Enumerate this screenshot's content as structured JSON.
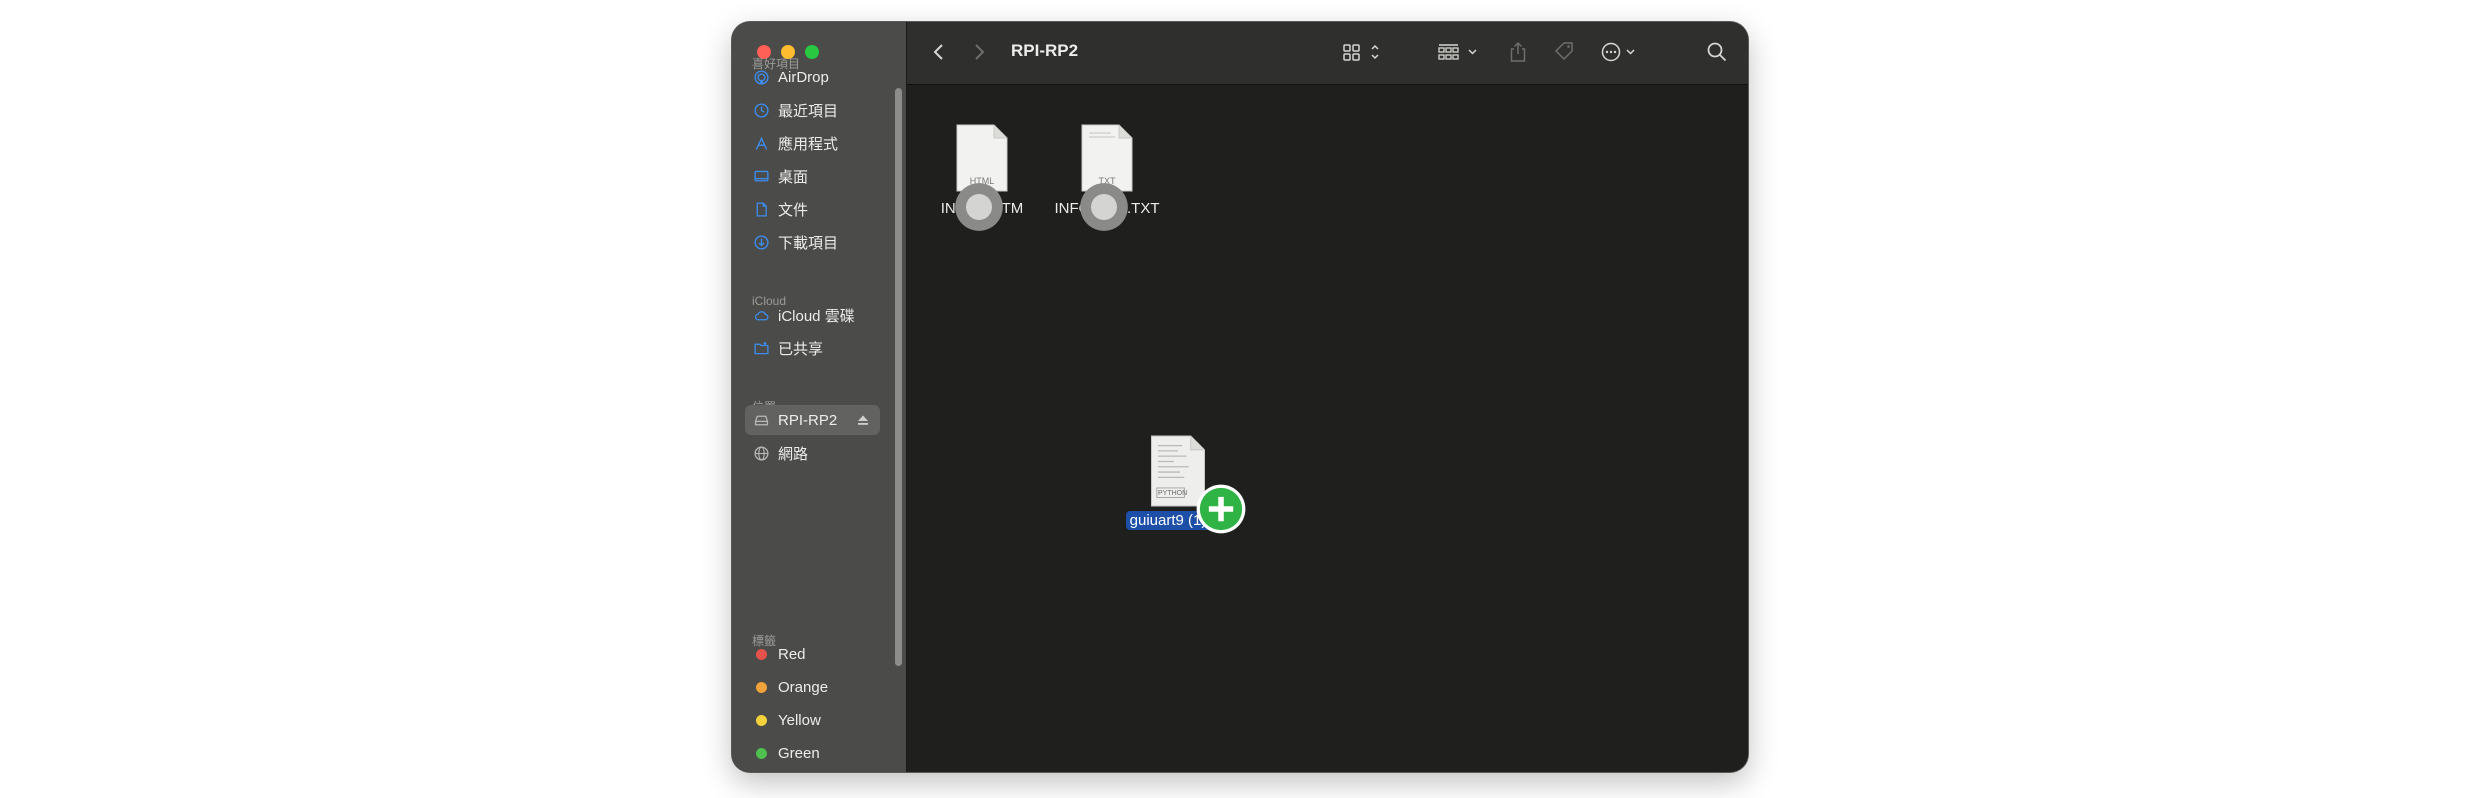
{
  "window": {
    "title": "RPI-RP2"
  },
  "sidebar": {
    "favorites_title": "喜好項目",
    "favorites": [
      {
        "label": "AirDrop",
        "icon": "airdrop-icon"
      },
      {
        "label": "最近項目",
        "icon": "clock-icon"
      },
      {
        "label": "應用程式",
        "icon": "applications-icon"
      },
      {
        "label": "桌面",
        "icon": "desktop-icon"
      },
      {
        "label": "文件",
        "icon": "document-icon"
      },
      {
        "label": "下載項目",
        "icon": "download-icon"
      }
    ],
    "icloud_title": "iCloud",
    "icloud": [
      {
        "label": "iCloud 雲碟",
        "icon": "cloud-icon"
      },
      {
        "label": "已共享",
        "icon": "shared-folder-icon"
      }
    ],
    "locations_title": "位置",
    "locations": [
      {
        "label": "RPI-RP2",
        "icon": "drive-icon",
        "selected": true
      },
      {
        "label": "網路",
        "icon": "globe-icon"
      }
    ],
    "tags_title": "標籤",
    "tags": [
      {
        "label": "Red",
        "color": "#e5514b"
      },
      {
        "label": "Orange",
        "color": "#f0a33a"
      },
      {
        "label": "Yellow",
        "color": "#f5d13b"
      },
      {
        "label": "Green",
        "color": "#4fbf4f"
      }
    ]
  },
  "files": [
    {
      "name": "INDEX.HTM",
      "type_label": "HTML"
    },
    {
      "name": "INFO_UF2.TXT",
      "type_label": "TXT"
    }
  ],
  "dragged_file": {
    "name": "guiuart9 (1).py",
    "type_label": "PYTHON"
  },
  "colors": {
    "accent_selection": "#1d4fa8",
    "sidebar_bg": "#4b4b49",
    "content_bg": "#1f1f1d",
    "sidebar_icon": "#3d8ef0",
    "add_badge": "#2fb344"
  }
}
